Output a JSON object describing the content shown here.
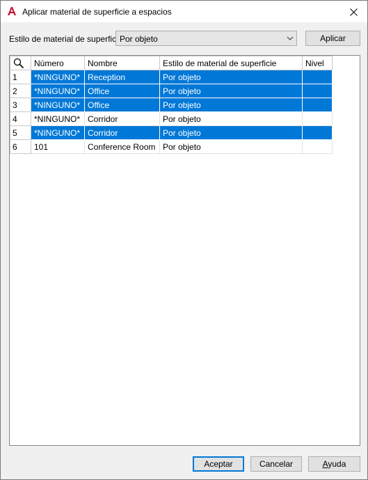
{
  "window": {
    "title": "Aplicar material de superficie a espacios",
    "close_glyph": "✕"
  },
  "style_row": {
    "label": "Estilo de material de superficie:",
    "selected_value": "Por objeto",
    "apply_button": "Aplicar"
  },
  "grid": {
    "columns": [
      "Número",
      "Nombre",
      "Estilo de material de superficie",
      "Nivel"
    ],
    "rows": [
      {
        "index": "1",
        "numero": "*NINGUNO*",
        "nombre": "Reception",
        "estilo": "Por objeto",
        "nivel": "",
        "selected": true
      },
      {
        "index": "2",
        "numero": "*NINGUNO*",
        "nombre": "Office",
        "estilo": "Por objeto",
        "nivel": "",
        "selected": true
      },
      {
        "index": "3",
        "numero": "*NINGUNO*",
        "nombre": "Office",
        "estilo": "Por objeto",
        "nivel": "",
        "selected": true
      },
      {
        "index": "4",
        "numero": "*NINGUNO*",
        "nombre": "Corridor",
        "estilo": "Por objeto",
        "nivel": "",
        "selected": false
      },
      {
        "index": "5",
        "numero": "*NINGUNO*",
        "nombre": "Corridor",
        "estilo": "Por objeto",
        "nivel": "",
        "selected": true
      },
      {
        "index": "6",
        "numero": "101",
        "nombre": "Conference Room",
        "estilo": "Por objeto",
        "nivel": "",
        "selected": false
      }
    ]
  },
  "footer": {
    "ok_button": "Aceptar",
    "cancel_button": "Cancelar",
    "help_button": "Ayuda"
  },
  "colors": {
    "selection": "#0078d7",
    "app_icon": "#c8102e"
  },
  "icons": {
    "app": "autocad-a-icon",
    "search": "search-icon",
    "dropdown": "chevron-down-icon",
    "close": "close-icon"
  }
}
